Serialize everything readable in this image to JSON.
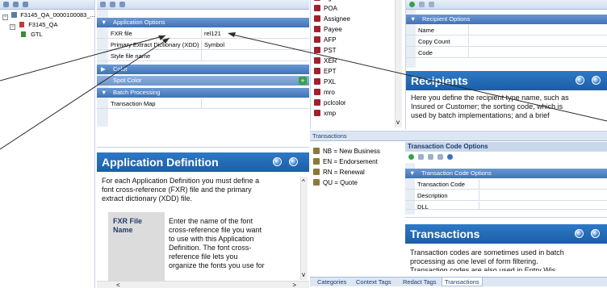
{
  "tree": {
    "root_label": "F3145_QA_0000100083_...",
    "child_label": "F3145_QA",
    "leaf_label": "GTL"
  },
  "app_grid": {
    "categories": [
      "Application Options",
      "Color",
      "Batch Processing"
    ],
    "rows": [
      {
        "key": "FXR file",
        "value": "rel121"
      },
      {
        "key": "Primary Extract Dictionary (XDD)",
        "value": "Symbol"
      },
      {
        "key": "Style file name",
        "value": ""
      }
    ],
    "color_rows": [
      {
        "key": "Spot Color",
        "value": ""
      }
    ],
    "batch_rows": [
      {
        "key": "Transaction Map",
        "value": ""
      }
    ]
  },
  "app_help": {
    "title": "Application Definition",
    "intro": [
      "For each Application Definition you must define a",
      "font cross-reference (FXR) file and the primary",
      "extract dictionary (XDD) file."
    ],
    "term": [
      "FXR File",
      "Name"
    ],
    "desc": [
      "Enter the name of the font",
      "cross-reference file you want",
      "to use with this Application",
      "Definition. The font cross-",
      "reference file lets you",
      "organize the fonts you use for"
    ]
  },
  "recipients_list": {
    "items": [
      "Agent",
      "POA",
      "Assignee",
      "Payee",
      "AFP",
      "PST",
      "XER",
      "EPT",
      "PXL",
      "mro",
      "pclcolor",
      "xmp"
    ]
  },
  "recipient_options": {
    "header": "Recipient Options",
    "rows": [
      "Name",
      "Copy Count",
      "Code"
    ]
  },
  "recipients_help": {
    "title": "Recipients",
    "body": [
      "Here you define the recipient type name, such as",
      "Insured or Customer; the sorting code, which is",
      "used by batch implementations; and a brief"
    ]
  },
  "transactions_pane": {
    "title": "Transactions",
    "items": [
      "NB = New Business",
      "EN = Endorsement",
      "RN = Renewal",
      "QU = Quote"
    ]
  },
  "transaction_code_options": {
    "title": "Transaction Code Options",
    "header": "Transaction Code Options",
    "rows": [
      "Transaction Code",
      "Description",
      "DLL"
    ]
  },
  "transactions_help": {
    "title": "Transactions",
    "body": [
      "Transaction codes are sometimes used in batch",
      "processing as one level of form filtering."
    ],
    "cut_line": "Transaction codes are also used in Entry Wis"
  },
  "bottom_tabs": [
    "Categories",
    "Context Tags",
    "Redact Tags",
    "Transactions"
  ],
  "active_tab": "Transactions",
  "colors": {
    "category_blue": "#3f72b8",
    "help_title_blue": "#1c5ea8",
    "toolbar_light": "#dde6f2",
    "list_icon_red": "#a0222e"
  }
}
